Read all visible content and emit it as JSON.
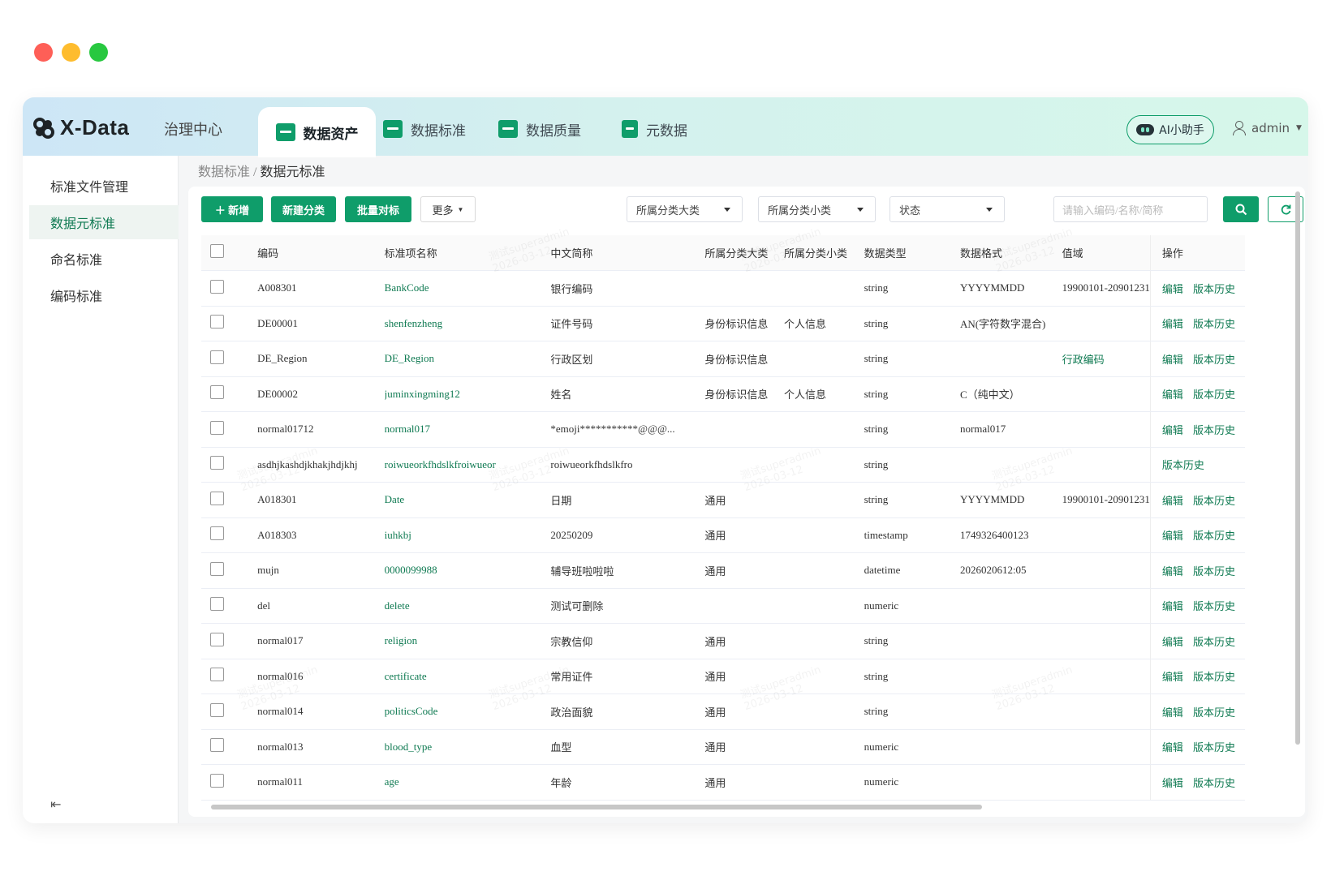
{
  "window": {
    "dot_colors": [
      "#fe5f57",
      "#febc2e",
      "#28c840"
    ]
  },
  "topbar": {
    "logo_text": "X-Data",
    "gov_center": "治理中心",
    "tabs": [
      {
        "label": "数据资产",
        "icon": "wallet-icon"
      },
      {
        "label": "数据标准",
        "icon": "chart-icon"
      },
      {
        "label": "数据质量",
        "icon": "quality-icon"
      },
      {
        "label": "元数据",
        "icon": "metadata-icon"
      }
    ],
    "ai_label": "AI小助手",
    "user_label": "admin"
  },
  "sidebar": {
    "items": [
      {
        "label": "标准文件管理"
      },
      {
        "label": "数据元标准"
      },
      {
        "label": "命名标准"
      },
      {
        "label": "编码标准"
      }
    ]
  },
  "breadcrumb": {
    "parent": "数据标准",
    "sep": " / ",
    "current": "数据元标准"
  },
  "toolbar": {
    "add_label": "＋ 新增",
    "new_category_label": "新建分类",
    "batch_label": "批量对标",
    "more_label": "更多",
    "filter_category_major": "所属分类大类",
    "filter_category_minor": "所属分类小类",
    "filter_status": "状态",
    "search_placeholder": "请输入编码/名称/简称"
  },
  "table": {
    "headers": [
      "编码",
      "标准项名称",
      "中文简称",
      "所属分类大类",
      "所属分类小类",
      "数据类型",
      "数据格式",
      "值域",
      "操作"
    ],
    "rows": [
      {
        "code": "A008301",
        "name": "BankCode",
        "cn": "银行编码",
        "major": "",
        "minor": "",
        "type": "string",
        "format": "YYYYMMDD",
        "range": "19900101-20901231",
        "edit": "编辑",
        "history": "版本历史"
      },
      {
        "code": "DE00001",
        "name": "shenfenzheng",
        "cn": "证件号码",
        "major": "身份标识信息",
        "minor": "个人信息",
        "type": "string",
        "format": "AN(字符数字混合)",
        "range": "",
        "edit": "编辑",
        "history": "版本历史"
      },
      {
        "code": "DE_Region",
        "name": "DE_Region",
        "cn": "行政区划",
        "major": "身份标识信息",
        "minor": "",
        "type": "string",
        "format": "",
        "range": "行政编码",
        "edit": "编辑",
        "history": "版本历史"
      },
      {
        "code": "DE00002",
        "name": "juminxingming12",
        "cn": "姓名",
        "major": "身份标识信息",
        "minor": "个人信息",
        "type": "string",
        "format": "C（纯中文）",
        "range": "",
        "edit": "编辑",
        "history": "版本历史"
      },
      {
        "code": "normal01712",
        "name": "normal017",
        "cn": "*emoji***********@@@...",
        "major": "",
        "minor": "",
        "type": "string",
        "format": "normal017",
        "range": "",
        "edit": "编辑",
        "history": "版本历史"
      },
      {
        "code": "asdhjkashdjkhakjhdjkhj",
        "name": "roiwueorkfhdslkfroiwueor",
        "cn": "roiwueorkfhdslkfro",
        "major": "",
        "minor": "",
        "type": "string",
        "format": "",
        "range": "",
        "edit": "",
        "history": "版本历史"
      },
      {
        "code": "A018301",
        "name": "Date",
        "cn": "日期",
        "major": "通用",
        "minor": "",
        "type": "string",
        "format": "YYYYMMDD",
        "range": "19900101-20901231",
        "edit": "编辑",
        "history": "版本历史"
      },
      {
        "code": "A018303",
        "name": "iuhkbj",
        "cn": "20250209",
        "major": "通用",
        "minor": "",
        "type": "timestamp",
        "format": "1749326400123",
        "range": "",
        "edit": "编辑",
        "history": "版本历史"
      },
      {
        "code": "mujn",
        "name": "0000099988",
        "cn": "辅导班啦啦啦",
        "major": "通用",
        "minor": "",
        "type": "datetime",
        "format": "2026020612:05",
        "range": "",
        "edit": "编辑",
        "history": "版本历史"
      },
      {
        "code": "del",
        "name": "delete",
        "cn": "测试可删除",
        "major": "",
        "minor": "",
        "type": "numeric",
        "format": "",
        "range": "",
        "edit": "编辑",
        "history": "版本历史"
      },
      {
        "code": "normal017",
        "name": "religion",
        "cn": "宗教信仰",
        "major": "通用",
        "minor": "",
        "type": "string",
        "format": "",
        "range": "",
        "edit": "编辑",
        "history": "版本历史"
      },
      {
        "code": "normal016",
        "name": "certificate",
        "cn": "常用证件",
        "major": "通用",
        "minor": "",
        "type": "string",
        "format": "",
        "range": "",
        "edit": "编辑",
        "history": "版本历史"
      },
      {
        "code": "normal014",
        "name": "politicsCode",
        "cn": "政治面貌",
        "major": "通用",
        "minor": "",
        "type": "string",
        "format": "",
        "range": "",
        "edit": "编辑",
        "history": "版本历史"
      },
      {
        "code": "normal013",
        "name": "blood_type",
        "cn": "血型",
        "major": "通用",
        "minor": "",
        "type": "numeric",
        "format": "",
        "range": "",
        "edit": "编辑",
        "history": "版本历史"
      },
      {
        "code": "normal011",
        "name": "age",
        "cn": "年龄",
        "major": "通用",
        "minor": "",
        "type": "numeric",
        "format": "",
        "range": "",
        "edit": "编辑",
        "history": "版本历史"
      }
    ]
  },
  "watermark": {
    "line1": "测试superadmin",
    "line2": "2026-03-12"
  },
  "colors": {
    "brand": "#0f9d6a",
    "link": "#0f7a52"
  }
}
